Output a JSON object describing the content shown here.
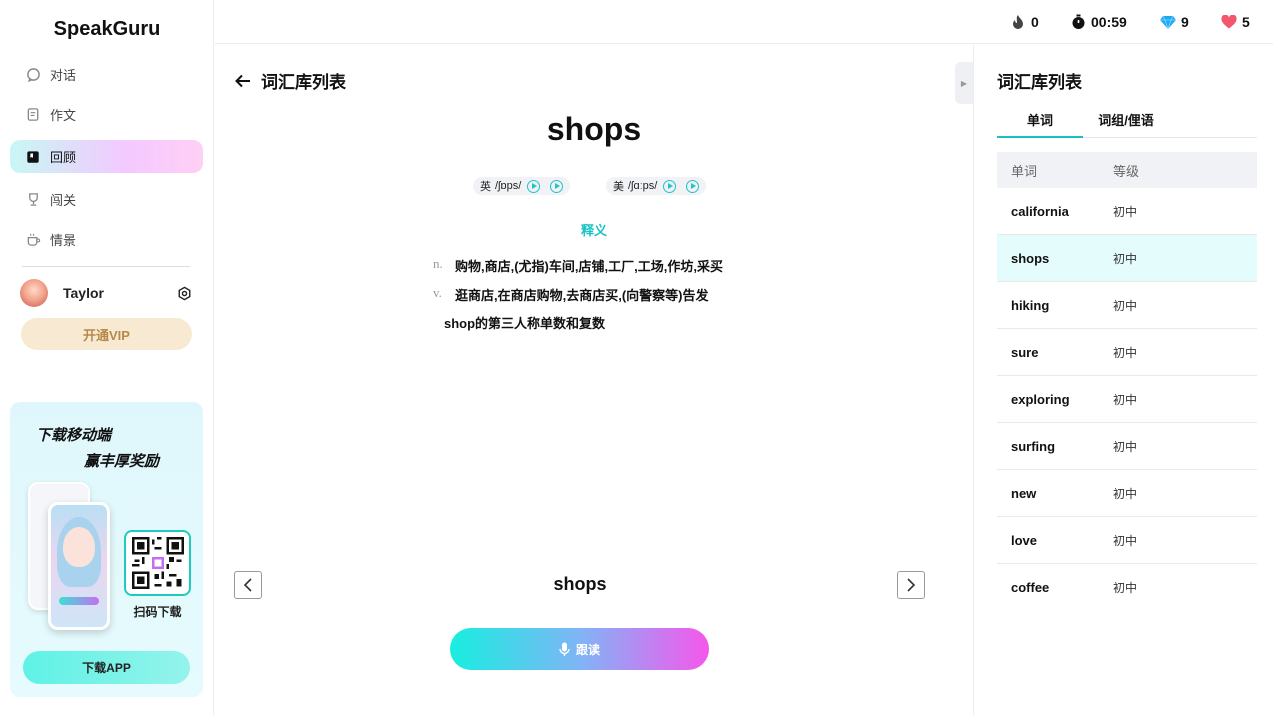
{
  "app": {
    "logo": "SpeakGuru"
  },
  "sidebar": {
    "items": [
      {
        "label": "对话",
        "icon": "chat-icon"
      },
      {
        "label": "作文",
        "icon": "edit-icon"
      },
      {
        "label": "回顾",
        "icon": "review-icon"
      },
      {
        "label": "闯关",
        "icon": "trophy-icon"
      },
      {
        "label": "情景",
        "icon": "coffee-icon"
      }
    ],
    "active_index": 2,
    "user": {
      "name": "Taylor"
    },
    "vip_label": "开通VIP",
    "promo": {
      "line1": "下载移动端",
      "line2": "赢丰厚奖励",
      "qr_label": "扫码下载",
      "download_label": "下载APP"
    }
  },
  "topbar": {
    "streak": "0",
    "timer": "00:59",
    "gems": "9",
    "hearts": "5"
  },
  "main": {
    "back_title": "词汇库列表",
    "word": "shops",
    "uk": {
      "label": "英",
      "ipa": "/ʃɒps/"
    },
    "us": {
      "label": "美",
      "ipa": "/ʃɑːps/"
    },
    "meaning_heading": "释义",
    "definitions": [
      {
        "pos": "n.",
        "text": "购物,商店,(尤指)车间,店铺,工厂,工场,作坊,采买"
      },
      {
        "pos": "v.",
        "text": "逛商店,在商店购物,去商店买,(向警察等)告发"
      }
    ],
    "extra": "shop的第三人称单数和复数",
    "bottom_word": "shops",
    "follow_label": "跟读"
  },
  "right_panel": {
    "title": "词汇库列表",
    "tabs": [
      "单词",
      "词组/俚语"
    ],
    "columns": [
      "单词",
      "等级"
    ],
    "rows": [
      {
        "word": "california",
        "level": "初中"
      },
      {
        "word": "shops",
        "level": "初中"
      },
      {
        "word": "hiking",
        "level": "初中"
      },
      {
        "word": "sure",
        "level": "初中"
      },
      {
        "word": "exploring",
        "level": "初中"
      },
      {
        "word": "surfing",
        "level": "初中"
      },
      {
        "word": "new",
        "level": "初中"
      },
      {
        "word": "love",
        "level": "初中"
      },
      {
        "word": "coffee",
        "level": "初中"
      }
    ],
    "selected_index": 1
  },
  "colors": {
    "accent": "#18c1c2",
    "vip_text": "#b78a48",
    "selected_row": "#e5fcfd"
  }
}
